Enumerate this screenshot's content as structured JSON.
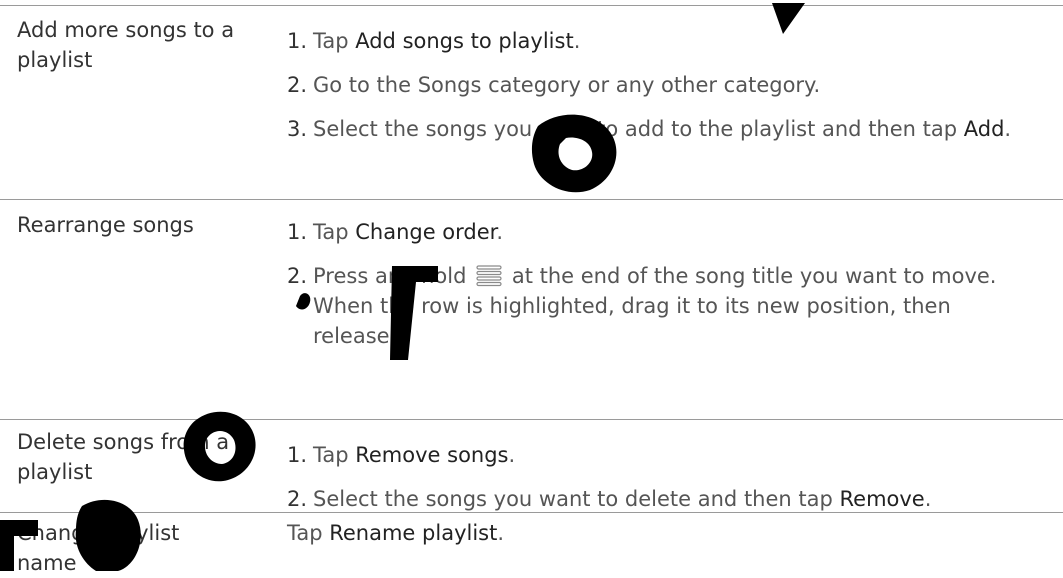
{
  "rows": [
    {
      "label": "Add more songs to a playlist",
      "steps": [
        {
          "num": "1.",
          "pre": "Tap ",
          "kw": "Add songs to playlist",
          "post": "."
        },
        {
          "num": "2.",
          "pre": "Go to the Songs category or any other category.",
          "kw": "",
          "post": ""
        },
        {
          "num": "3.",
          "pre": "Select the songs you want to add to the playlist and then tap ",
          "kw": "Add",
          "post": "."
        }
      ]
    },
    {
      "label": "Rearrange songs",
      "steps": [
        {
          "num": "1.",
          "pre": "Tap ",
          "kw": "Change order",
          "post": "."
        },
        {
          "num": "2.",
          "pre": "Press and hold",
          "icon": "drag-handle-icon",
          "post": "at the end of the song title you want to move. When the row is highlighted, drag it to its new position, then release."
        }
      ]
    },
    {
      "label": "Delete songs from a playlist",
      "steps": [
        {
          "num": "1.",
          "pre": "Tap ",
          "kw": "Remove songs",
          "post": "."
        },
        {
          "num": "2.",
          "pre": "Select the songs you want to delete and then tap ",
          "kw": "Remove",
          "post": "."
        }
      ]
    },
    {
      "label": "Change playlist name",
      "text": {
        "pre": "Tap ",
        "kw": "Rename playlist",
        "post": "."
      }
    }
  ],
  "colors": {
    "rule": "#9a9a9a",
    "text": "#555555",
    "keyword": "#222222",
    "watermark": "#000000"
  }
}
